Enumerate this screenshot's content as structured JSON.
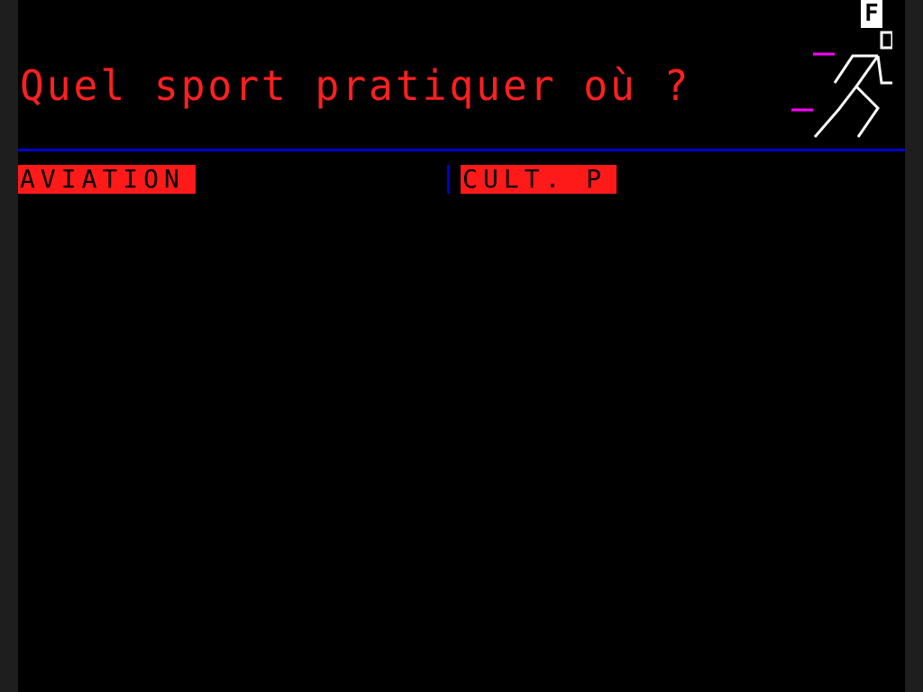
{
  "header": {
    "title": "Quel sport pratiquer où ?",
    "badge": "F",
    "logo_icon": "running-figure-icon"
  },
  "menu": {
    "items": [
      {
        "label": "AVIATION"
      },
      {
        "label": "CULT. P"
      }
    ]
  },
  "colors": {
    "background": "#000000",
    "title": "#ff2020",
    "item_bg": "#ff1a1a",
    "item_text": "#000000",
    "divider": "#0000cc",
    "figure": "#ffffff",
    "speed_lines": "#ff00ff"
  }
}
